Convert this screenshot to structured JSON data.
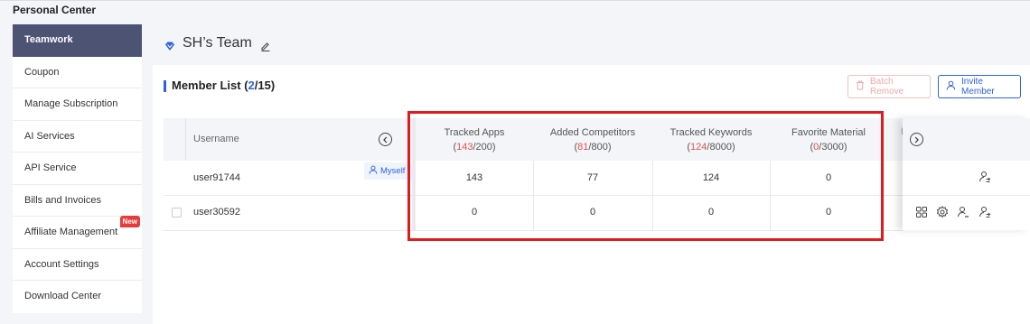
{
  "page": {
    "title": "Personal Center"
  },
  "sidebar": {
    "items": [
      {
        "label": "Teamwork",
        "active": true
      },
      {
        "label": "Coupon"
      },
      {
        "label": "Manage Subscription"
      },
      {
        "label": "AI Services"
      },
      {
        "label": "API Service"
      },
      {
        "label": "Bills and Invoices"
      },
      {
        "label": "Affiliate Management",
        "badge": "New"
      },
      {
        "label": "Account Settings"
      },
      {
        "label": "Download Center"
      }
    ]
  },
  "team": {
    "name": "SH’s Team"
  },
  "member_list": {
    "title": "Member List",
    "open": "(",
    "current": "2",
    "sep": "/",
    "total": "15",
    "close": ")",
    "batch_remove_label": "Batch Remove",
    "invite_label": "Invite Member"
  },
  "table": {
    "username_header": "Username",
    "columns": [
      {
        "label": "Tracked Apps",
        "used": "143",
        "limit": "200"
      },
      {
        "label": "Added Competitors",
        "used": "81",
        "limit": "800"
      },
      {
        "label": "Tracked Keywords",
        "used": "124",
        "limit": "8000"
      },
      {
        "label": "Favorite Material",
        "used": "0",
        "limit": "3000"
      }
    ],
    "rows": [
      {
        "username": "user91744",
        "tag": "Myself",
        "values": [
          "143",
          "77",
          "124",
          "0"
        ]
      },
      {
        "username": "user30592",
        "values": [
          "0",
          "0",
          "0",
          "0"
        ]
      }
    ]
  },
  "colors": {
    "accent": "#2e63e0",
    "sidebar_active": "#4d5372",
    "highlight": "#e01b1b",
    "limit_red": "#e65050"
  },
  "icons": [
    "diamond-icon",
    "edit-icon",
    "trash-icon",
    "user-icon",
    "chevron-left-icon",
    "chevron-right-icon",
    "grid-icon",
    "gear-icon",
    "user-minus-icon",
    "user-transfer-icon"
  ]
}
